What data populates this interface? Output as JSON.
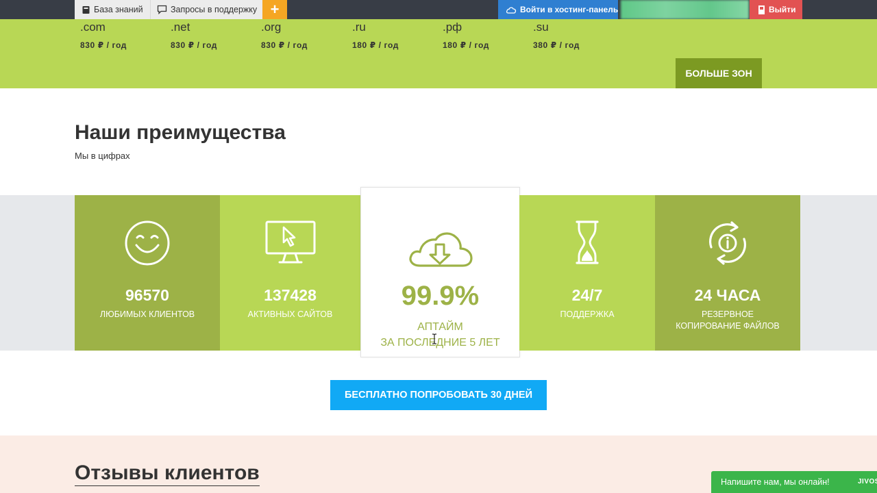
{
  "topbar": {
    "knowledge_base": "База знаний",
    "support_requests": "Запросы в поддержку",
    "add": "+",
    "hosting_panel": "Войти в хостинг-панель",
    "logout": "Выйти"
  },
  "domains": {
    "zones": [
      {
        "name": ".com",
        "price": "830 ₽  / год"
      },
      {
        "name": ".net",
        "price": "830 ₽  / год"
      },
      {
        "name": ".org",
        "price": "830 ₽  / год"
      },
      {
        "name": ".ru",
        "price": "180 ₽  / год"
      },
      {
        "name": ".рф",
        "price": "180 ₽  / год"
      },
      {
        "name": ".su",
        "price": "380 ₽  / год"
      }
    ],
    "more_button": "БОЛЬШЕ ЗОН"
  },
  "advantages": {
    "title": "Наши преимущества",
    "subtitle": "Мы в цифрах",
    "stats": [
      {
        "icon": "smiley-icon",
        "value": "96570",
        "label": "ЛЮБИМЫХ КЛИЕНТОВ"
      },
      {
        "icon": "monitor-cursor-icon",
        "value": "137428",
        "label": "АКТИВНЫХ САЙТОВ"
      },
      {
        "icon": "cloud-download-icon",
        "value": "99.9%",
        "label_line1": "АПТАЙМ",
        "label_line2": "ЗА ПОСЛЕДНИЕ 5 ЛЕТ"
      },
      {
        "icon": "hourglass-icon",
        "value": "24/7",
        "label": "ПОДДЕРЖКА"
      },
      {
        "icon": "backup-sync-icon",
        "value": "24 ЧАСА",
        "label_line1": "РЕЗЕРВНОЕ",
        "label_line2": "КОПИРОВАНИЕ ФАЙЛОВ"
      }
    ],
    "trial_button": "БЕСПЛАТНО ПОПРОБОВАТЬ 30 ДНЕЙ"
  },
  "reviews": {
    "title": "Отзывы клиентов"
  },
  "chat": {
    "label": "Напишите нам, мы онлайн!",
    "brand": "JIVOS"
  },
  "colors": {
    "lime": "#b8d755",
    "olive": "#9db247",
    "dark_olive": "#7c9a22",
    "blue": "#11a9f5",
    "panel_blue": "#2f7fd1",
    "logout_red": "#e25252",
    "chat_green": "#3bb54a",
    "reviews_bg": "#fbece5"
  }
}
